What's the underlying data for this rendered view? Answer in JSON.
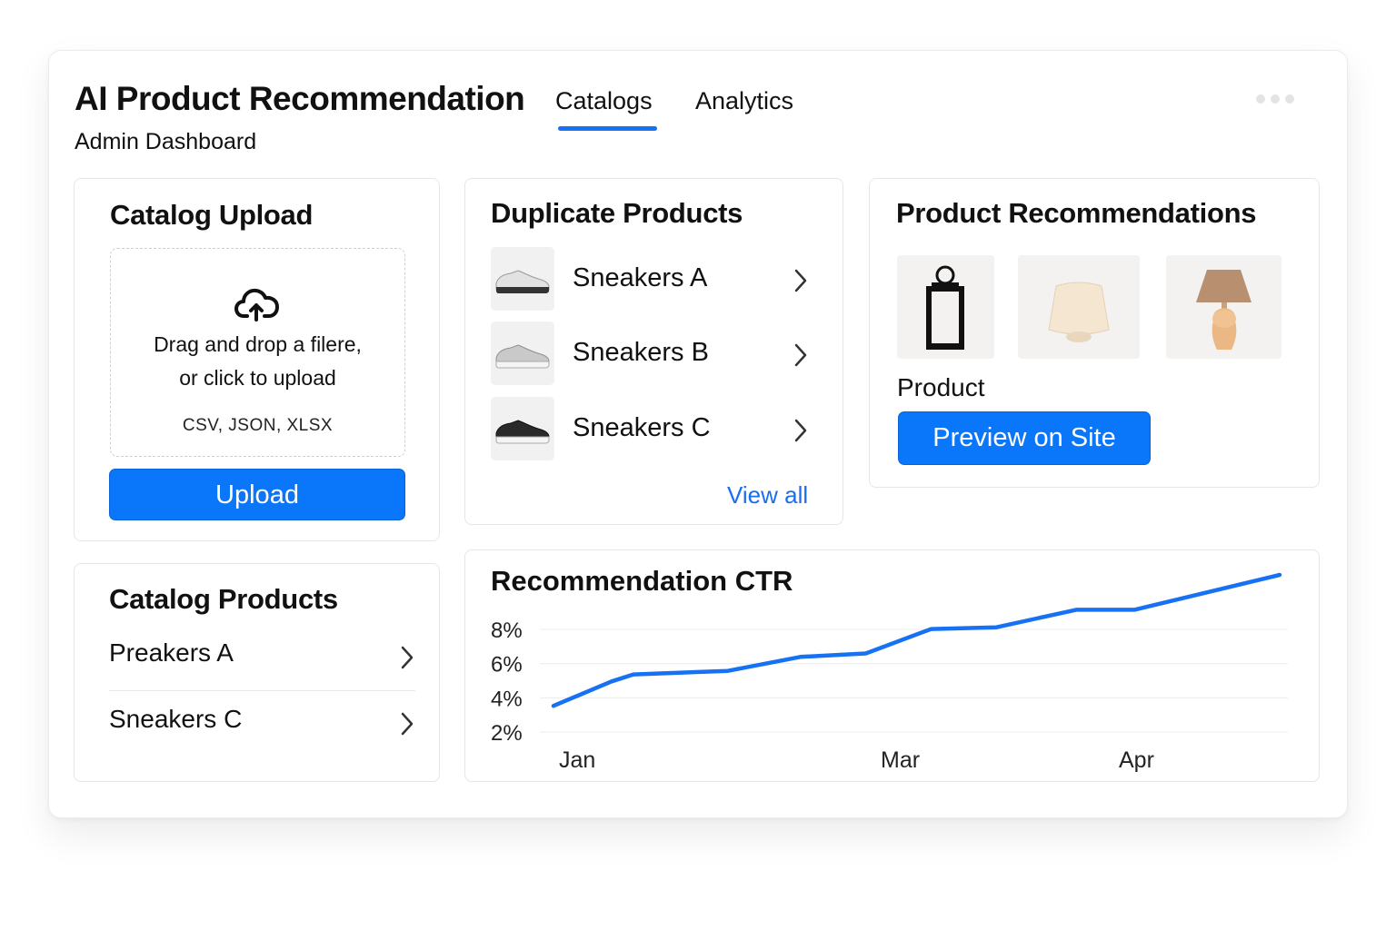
{
  "header": {
    "title": "AI Product Recommendation",
    "subtitle": "Admin Dashboard",
    "tabs": [
      {
        "label": "Catalogs",
        "active": true
      },
      {
        "label": "Analytics",
        "active": false
      }
    ],
    "more_icon": "more-horizontal-icon"
  },
  "catalog_upload": {
    "title": "Catalog Upload",
    "icon": "cloud-upload-icon",
    "drop_line1": "Drag and drop a filere,",
    "drop_line2": "or click to upload",
    "formats": "CSV, JSON, XLSX",
    "button_label": "Upload"
  },
  "duplicate_products": {
    "title": "Duplicate Products",
    "items": [
      {
        "label": "Sneakers A",
        "thumb": "sneaker-white-icon"
      },
      {
        "label": "Sneakers B",
        "thumb": "sneaker-gray-icon"
      },
      {
        "label": "Sneakers C",
        "thumb": "sneaker-black-icon"
      }
    ],
    "view_all": "View all"
  },
  "recommendations": {
    "title": "Product Recommendations",
    "images": [
      "lantern-image",
      "lamp-shade-image",
      "table-lamp-image"
    ],
    "product_label": "Product",
    "button_label": "Preview on Site"
  },
  "catalog_products": {
    "title": "Catalog Products",
    "items": [
      {
        "label": "Preakers A"
      },
      {
        "label": "Sneakers C"
      }
    ]
  },
  "colors": {
    "accent": "#0a76fa",
    "link": "#1a6ef0",
    "line": "#1672f3"
  },
  "chart_data": {
    "type": "line",
    "title": "Recommendation CTR",
    "xlabel": "",
    "ylabel": "",
    "x_tick_labels": [
      "Jan",
      "Mar",
      "Apr"
    ],
    "y_tick_labels": [
      "8%",
      "6%",
      "4%",
      "2%"
    ],
    "y_ticks": [
      8,
      6,
      4,
      2
    ],
    "ylim": [
      2,
      8
    ],
    "grid": true,
    "x": [
      0,
      0.08,
      0.11,
      0.24,
      0.34,
      0.43,
      0.52,
      0.61,
      0.72,
      0.8,
      1.0
    ],
    "series": [
      {
        "values": [
          3.5,
          4.9,
          5.3,
          5.5,
          6.3,
          6.5,
          7.9,
          8.0,
          9.0,
          9.0,
          11.0
        ]
      }
    ]
  }
}
